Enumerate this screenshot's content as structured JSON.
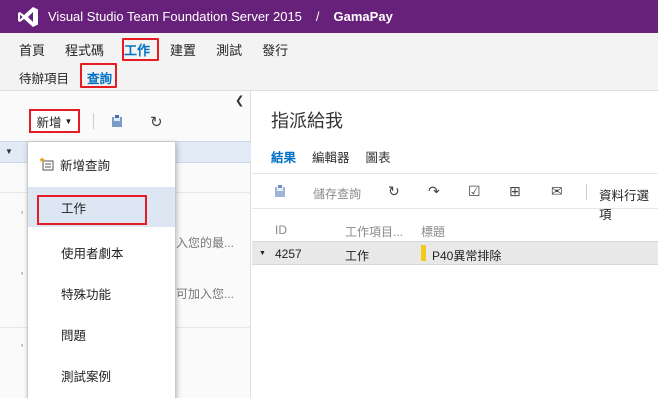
{
  "app": {
    "product_name": "Visual Studio Team Foundation Server 2015",
    "separator": "/",
    "project_name": "GamaPay",
    "brand_color": "#68217a"
  },
  "nav": {
    "items": [
      {
        "label": "首頁"
      },
      {
        "label": "程式碼"
      },
      {
        "label": "工作"
      },
      {
        "label": "建置"
      },
      {
        "label": "測試"
      },
      {
        "label": "發行"
      }
    ],
    "sub_items": [
      {
        "label": "待辦項目"
      },
      {
        "label": "查詢"
      }
    ],
    "active_item": "工作",
    "active_sub_item": "查詢"
  },
  "left_pane": {
    "new_button_label": "新增",
    "collapse_icon": "chevron-left-icon",
    "snippet_1": "入您的最...",
    "snippet_2": "可加入您..."
  },
  "new_menu": {
    "items": [
      {
        "label": "新增查詢",
        "icon": "new-query-icon"
      },
      {
        "label": "工作"
      },
      {
        "label": "使用者劇本"
      },
      {
        "label": "特殊功能"
      },
      {
        "label": "問題"
      },
      {
        "label": "測試案例"
      }
    ],
    "highlighted": "工作"
  },
  "right_pane": {
    "title": "指派給我",
    "tabs": [
      {
        "label": "結果"
      },
      {
        "label": "編輯器"
      },
      {
        "label": "圖表"
      }
    ],
    "active_tab": "結果",
    "toolbar": {
      "save_query_label": "儲存查詢",
      "column_options_label": "資料行選項"
    },
    "grid": {
      "columns": [
        "ID",
        "工作項目...",
        "標題"
      ],
      "rows": [
        {
          "id": "4257",
          "type": "工作",
          "title": "P40異常排除",
          "state_color": "#f2cb1d"
        }
      ]
    }
  },
  "colors": {
    "accent": "#0072c6",
    "highlight_box": "#e51c23",
    "selected_row": "#e1eaf5"
  }
}
